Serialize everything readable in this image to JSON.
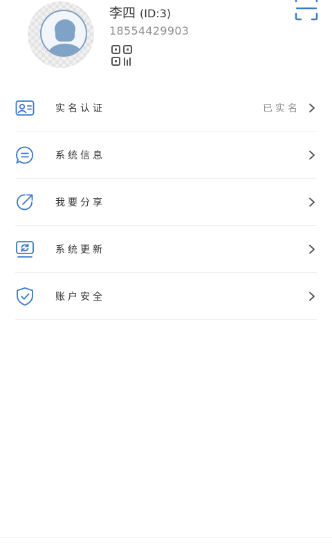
{
  "profile": {
    "name": "李四",
    "id_label": "(ID:3)",
    "phone": "18554429903"
  },
  "icons": {
    "avatar": "user-avatar",
    "qr": "qr-code-icon",
    "scan": "scan-icon",
    "chevron": "chevron-right-icon"
  },
  "colors": {
    "accent": "#3a77c9",
    "text": "#333333",
    "muted": "#8a8a8a"
  },
  "menu": {
    "items": [
      {
        "label": "实名认证",
        "value": "已实名",
        "icon": "id-card-icon"
      },
      {
        "label": "系统信息",
        "icon": "message-icon"
      },
      {
        "label": "我要分享",
        "icon": "share-icon"
      },
      {
        "label": "系统更新",
        "icon": "update-icon"
      },
      {
        "label": "账户安全",
        "icon": "shield-icon"
      }
    ]
  }
}
